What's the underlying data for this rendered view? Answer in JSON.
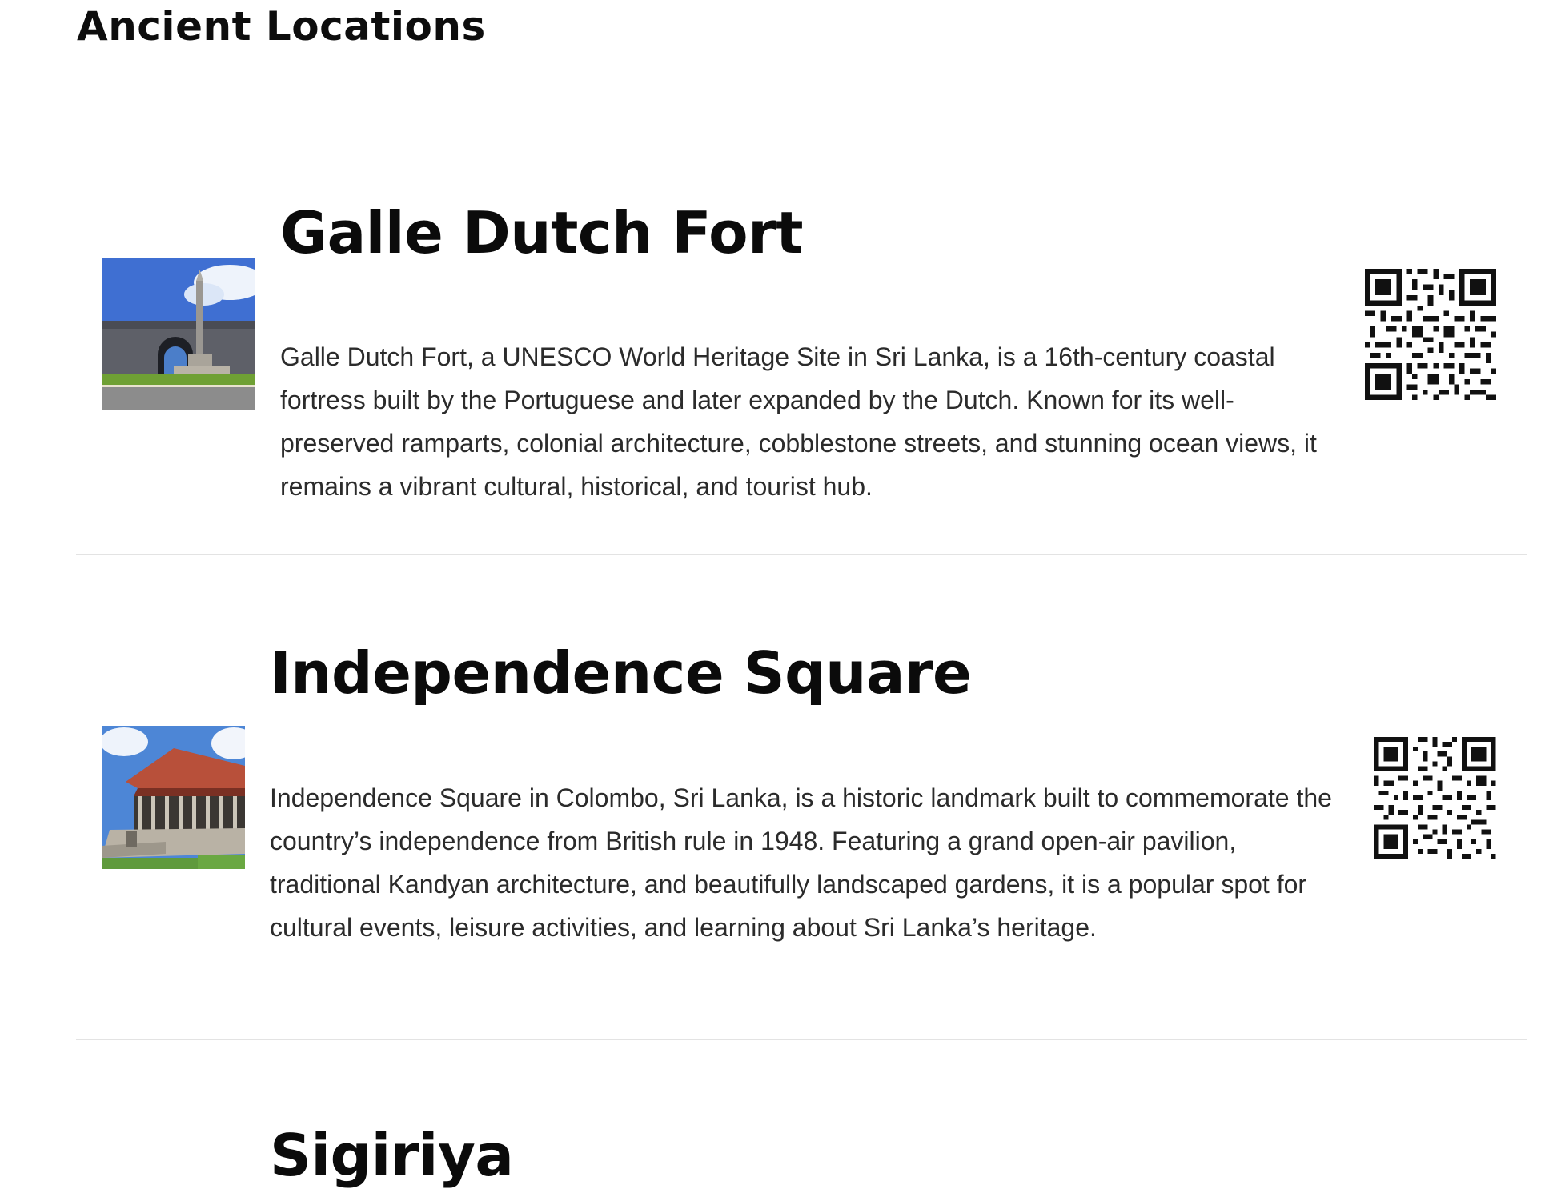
{
  "page": {
    "heading": "Ancient Locations"
  },
  "locations": [
    {
      "title": "Galle Dutch Fort",
      "description": "Galle Dutch Fort, a UNESCO World Heritage Site in Sri Lanka, is a 16th-century coastal fortress built by the Portuguese and later expanded by the Dutch. Known for its well-preserved ramparts, colonial architecture, cobblestone streets, and stunning ocean views, it remains a vibrant cultural, historical, and tourist hub.",
      "photo": "fort-gate-with-obelisk-photo",
      "qr_icon": "qr-code-icon"
    },
    {
      "title": "Independence Square",
      "description": "Independence Square in Colombo, Sri Lanka, is a historic landmark built to commemorate the country’s independence from British rule in 1948. Featuring a grand open-air pavilion, traditional Kandyan architecture, and beautifully landscaped gardens, it is a popular spot for cultural events, leisure activities, and learning about Sri Lanka’s heritage.",
      "photo": "pavilion-photo",
      "qr_icon": "qr-code-icon"
    },
    {
      "title": "Sigiriya"
    }
  ],
  "colors": {
    "heading": "#0b0b0b",
    "body_text": "#2b2b2b",
    "divider": "#e3e3e3",
    "background": "#ffffff"
  }
}
